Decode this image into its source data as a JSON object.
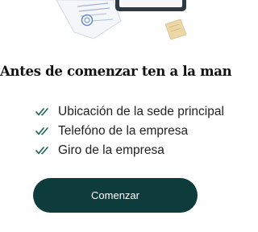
{
  "heading": "Antes de comenzar ten a la mano",
  "checklist": {
    "items": [
      {
        "label": "Ubicación de la sede principal",
        "icon": "double-check-icon"
      },
      {
        "label": "Telefóno de la empresa",
        "icon": "double-check-icon"
      },
      {
        "label": "Giro de la empresa",
        "icon": "double-check-icon"
      }
    ]
  },
  "cta": {
    "label": "Comenzar"
  },
  "colors": {
    "accent": "#0e3c3d",
    "check": "#1f6b4f",
    "text": "#222222"
  }
}
